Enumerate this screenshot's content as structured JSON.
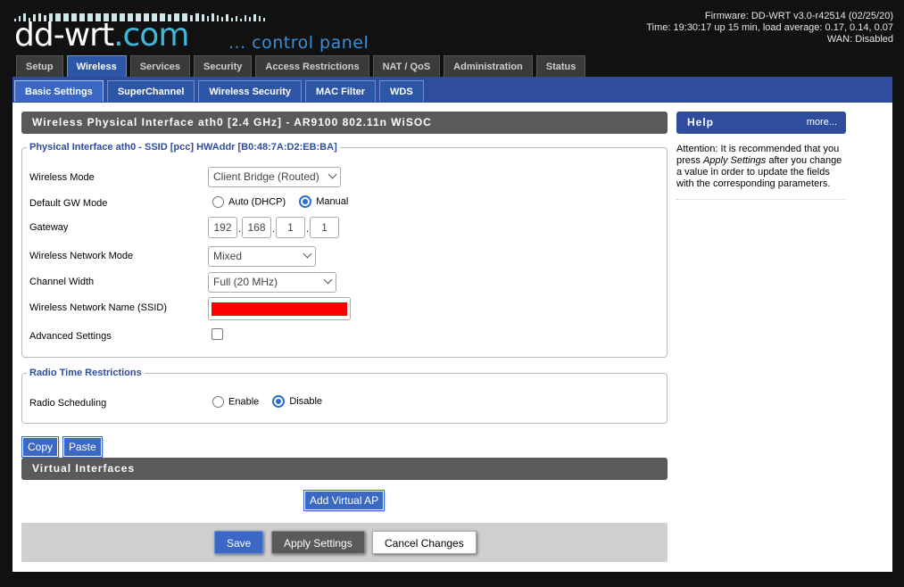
{
  "header": {
    "logo_main": "dd-wrt",
    "logo_dotcom": ".com",
    "logo_tagline": "... control panel",
    "firmware": "Firmware: DD-WRT v3.0-r42514 (02/25/20)",
    "time": "Time: 19:30:17 up 15 min, load average: 0.17, 0.14, 0.07",
    "wan": "WAN: Disabled"
  },
  "main_tabs": [
    "Setup",
    "Wireless",
    "Services",
    "Security",
    "Access Restrictions",
    "NAT / QoS",
    "Administration",
    "Status"
  ],
  "sub_tabs": [
    "Basic Settings",
    "SuperChannel",
    "Wireless Security",
    "MAC Filter",
    "WDS"
  ],
  "interface_title": "Wireless Physical Interface ath0 [2.4 GHz] - AR9100 802.11n WiSOC",
  "physical": {
    "legend": "Physical Interface ath0 - SSID [pcc] HWAddr [B0:48:7A:D2:EB:BA]",
    "wireless_mode_label": "Wireless Mode",
    "wireless_mode_value": "Client Bridge (Routed)",
    "gw_mode_label": "Default GW Mode",
    "gw_opt_auto": "Auto (DHCP)",
    "gw_opt_manual": "Manual",
    "gateway_label": "Gateway",
    "gateway": [
      "192",
      "168",
      "1",
      "1"
    ],
    "ip_dot": ".",
    "net_mode_label": "Wireless Network Mode",
    "net_mode_value": "Mixed",
    "channel_width_label": "Channel Width",
    "channel_width_value": "Full (20 MHz)",
    "ssid_label": "Wireless Network Name (SSID)",
    "ssid_redaction_color": "#ff0000",
    "advanced_label": "Advanced Settings"
  },
  "radio": {
    "legend": "Radio Time Restrictions",
    "scheduling_label": "Radio Scheduling",
    "opt_enable": "Enable",
    "opt_disable": "Disable"
  },
  "buttons": {
    "copy": "Copy",
    "paste": "Paste",
    "add_virtual_ap": "Add Virtual AP",
    "save": "Save",
    "apply": "Apply Settings",
    "cancel": "Cancel Changes"
  },
  "virtual_title": "Virtual Interfaces",
  "help": {
    "title": "Help",
    "more": "more...",
    "text_before": "Attention: It is recommended that you press ",
    "text_em": "Apply Settings",
    "text_after": " after you change a value in order to update the fields with the corresponding parameters."
  },
  "colors": {
    "accent_blue": "#2e4d9d",
    "tab_blue": "#2e56a6",
    "section_gray": "#5a5a5a"
  }
}
